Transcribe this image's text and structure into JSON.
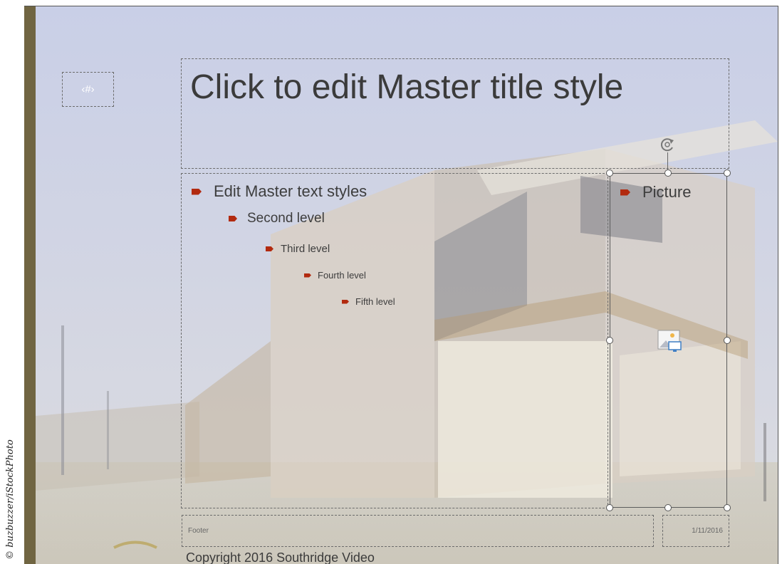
{
  "credit": "© buzbuzzer/iStockPhoto",
  "slide_number_placeholder": "‹#›",
  "title_placeholder": "Click to edit Master title style",
  "body_levels": [
    "Edit Master text styles",
    "Second level",
    "Third level",
    "Fourth level",
    "Fifth level"
  ],
  "picture_placeholder": {
    "label": "Picture",
    "icon": "insert-picture-icon"
  },
  "footer": "Footer",
  "date": "1/11/2016",
  "copyright": "Copyright 2016 Southridge Video",
  "colors": {
    "accent_bar": "#706542",
    "bullet": "#b22a0f",
    "text": "#3b3b3b"
  },
  "icons": [
    "rotate-handle-icon",
    "insert-picture-icon",
    "bullet-arrow-icon"
  ]
}
